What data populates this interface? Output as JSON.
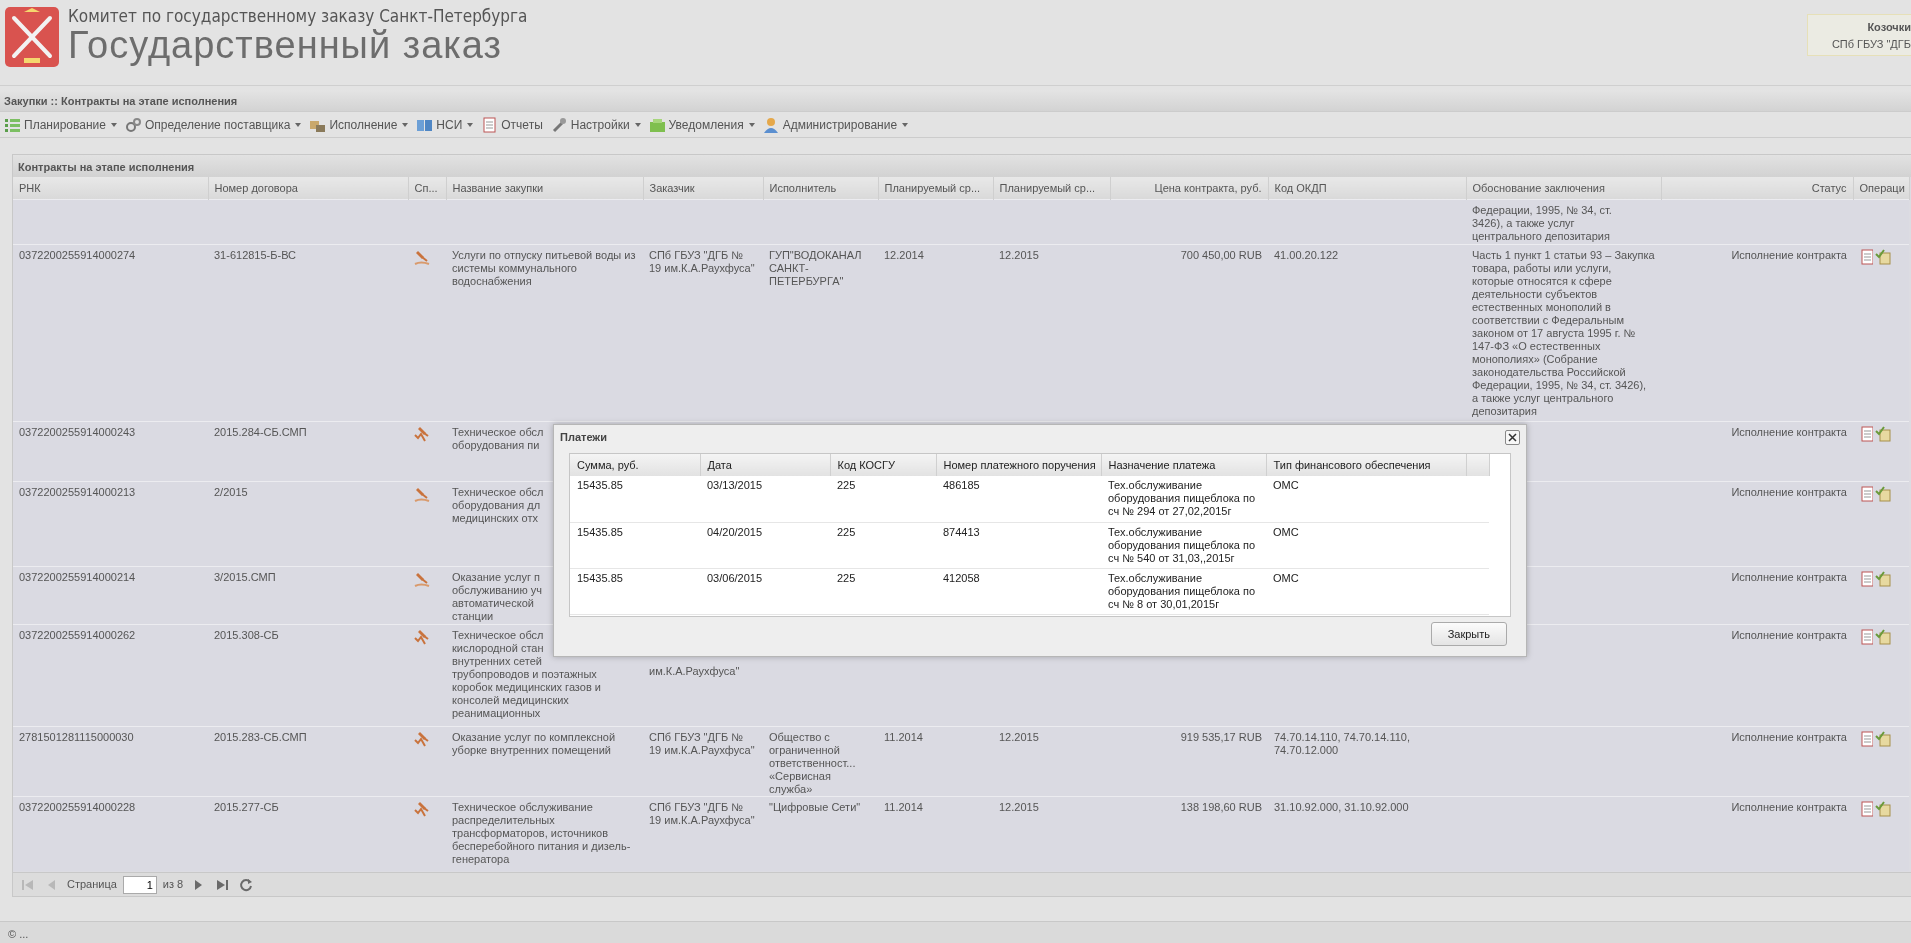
{
  "header": {
    "org": "Комитет по государственному заказу Санкт-Петербурга",
    "title": "Государственный заказ",
    "user_name": "Козочки",
    "user_org": "СПб ГБУЗ \"ДГБ"
  },
  "breadcrumb": "Закупки :: Контракты на этапе исполнения",
  "menu": [
    {
      "label": "Планирование",
      "has_menu": true
    },
    {
      "label": "Определение поставщика",
      "has_menu": true
    },
    {
      "label": "Исполнение",
      "has_menu": true
    },
    {
      "label": "НСИ",
      "has_menu": true
    },
    {
      "label": "Отчеты",
      "has_menu": false
    },
    {
      "label": "Настройки",
      "has_menu": true
    },
    {
      "label": "Уведомления",
      "has_menu": true
    },
    {
      "label": "Администрирование",
      "has_menu": true
    }
  ],
  "panel": {
    "title": "Контракты на этапе исполнения",
    "columns": [
      "РНК",
      "Номер договора",
      "Сп...",
      "Название закупки",
      "Заказчик",
      "Исполнитель",
      "Планируемый ср...",
      "Планируемый ср...",
      "Цена контракта, руб.",
      "Код ОКДП",
      "Обоснование заключения",
      "Статус",
      "Операци"
    ],
    "rows": [
      {
        "basis": "Федерации, 1995, № 34, ст.\n3426), а также услуг\nцентрального депозитария"
      },
      {
        "rnk": "0372200255914000274",
        "number": "31-612815-Б-ВС",
        "kind": "hand",
        "name": "Услуги по отпуску питьевой воды из системы коммунального водоснабжения",
        "customer": "СПб ГБУЗ \"ДГБ № 19 им.К.А.Раухфуса\"",
        "contractor": "ГУП\"ВОДОКАНАЛ САНКТ-ПЕТЕРБУРГА\"",
        "plan_start": "12.2014",
        "plan_end": "12.2015",
        "price": "700 450,00 RUB",
        "okdp": "41.00.20.122",
        "basis": "Часть 1 пункт 1 статьи 93 – Закупка товара, работы или услуги, которые относятся к сфере деятельности субъектов естественных монополий в соответствии с Федеральным законом от 17 августа 1995 г. № 147-ФЗ «О естественных монополиях» (Собрание законодательства Российской Федерации, 1995, № 34, ст. 3426), а также услуг центрального депозитария",
        "status": "Исполнение контракта"
      },
      {
        "rnk": "0372200255914000243",
        "number": "2015.284-СБ.СМП",
        "kind": "arrow",
        "name": "Техническое обсл\nоборудования пи",
        "status": "Исполнение контракта"
      },
      {
        "rnk": "0372200255914000213",
        "number": "2/2015",
        "kind": "hand",
        "name": "Техническое обсл\nоборудования дл\nмедицинских отх",
        "status": "Исполнение контракта"
      },
      {
        "rnk": "0372200255914000214",
        "number": "3/2015.СМП",
        "kind": "hand",
        "name": "Оказание услуг п\nобслуживанию уч\nавтоматической\nстанции",
        "status": "Исполнение контракта"
      },
      {
        "rnk": "0372200255914000262",
        "number": "2015.308-СБ",
        "kind": "arrow",
        "name": "Техническое обсл\nкислородной стан\nвнутренних сетей\nтрубопроводов и поэтажных\nкоробок медицинских газов и\nконсолей медицинских\nреанимационных",
        "customer": "им.К.А.Раухфуса\"",
        "customer_tail": true,
        "status": "Исполнение контракта"
      },
      {
        "rnk": "2781501281115000030",
        "number": "2015.283-СБ.СМП",
        "kind": "arrow",
        "name": "Оказание услуг по комплексной уборке внутренних помещений",
        "customer": "СПб ГБУЗ \"ДГБ № 19 им.К.А.Раухфуса\"",
        "contractor": "Общество с ограниченной ответственност... «Сервисная служба»",
        "plan_start": "11.2014",
        "plan_end": "12.2015",
        "price": "919 535,17 RUB",
        "okdp": "74.70.14.110, 74.70.14.110, 74.70.12.000",
        "status": "Исполнение контракта"
      },
      {
        "rnk": "0372200255914000228",
        "number": "2015.277-СБ",
        "kind": "arrow",
        "name": "Техническое обслуживание распределительных трансформаторов, источников бесперебойного питания и дизель-генератора",
        "customer": "СПб ГБУЗ \"ДГБ № 19 им.К.А.Раухфуса\"",
        "contractor": "\"Цифровые Сети\"",
        "plan_start": "11.2014",
        "plan_end": "12.2015",
        "price": "138 198,60 RUB",
        "okdp": "31.10.92.000, 31.10.92.000",
        "status": "Исполнение контракта"
      }
    ],
    "pager": {
      "page_label": "Страница",
      "page": "1",
      "of_label": "из 8",
      "nav": [
        {
          "kind": "first",
          "disabled": true
        },
        {
          "kind": "prev",
          "disabled": true
        },
        {
          "kind": "next",
          "disabled": false
        },
        {
          "kind": "last",
          "disabled": false
        },
        {
          "kind": "refresh",
          "disabled": false
        }
      ]
    }
  },
  "dialog": {
    "title": "Платежи",
    "columns": [
      "Сумма, руб.",
      "Дата",
      "Код КОСГУ",
      "Номер платежного поручения",
      "Назначение платежа",
      "Тип финансового обеспечения"
    ],
    "rows": [
      [
        "15435.85",
        "03/13/2015",
        "225",
        "486185",
        "Тех.обслуживание оборудования пищеблока по сч № 294 от 27,02,2015г",
        "ОМС"
      ],
      [
        "15435.85",
        "04/20/2015",
        "225",
        "874413",
        "Тех.обслуживание оборудования пищеблока по сч № 540 от 31,03,,2015г",
        "ОМС"
      ],
      [
        "15435.85",
        "03/06/2015",
        "225",
        "412058",
        "Тех.обслуживание оборудования пищеблока по сч № 8 от 30,01,2015г",
        "ОМС"
      ]
    ],
    "close_button": "Закрыть"
  },
  "footer": "© ..."
}
